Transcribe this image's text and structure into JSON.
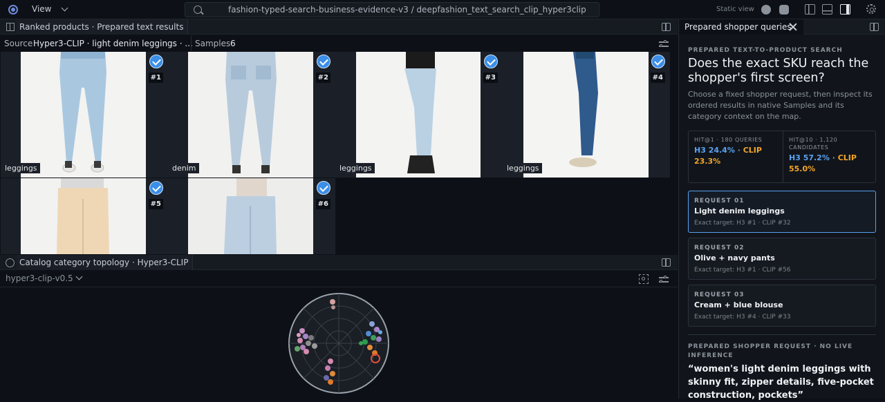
{
  "topbar": {
    "view_label": "View",
    "search_value": "fashion-typed-search-business-evidence-v3 / deepfashion_text_search_clip_hyper3clip",
    "static_label": "Static view"
  },
  "results_panel": {
    "title": "Ranked products · Prepared text results",
    "source_label": "Source",
    "source_value": "Hyper3-CLIP · light denim leggings · ...",
    "samples_label": "Samples",
    "samples_count": "6",
    "tiles": [
      {
        "tag": "leggings",
        "rank": "#1",
        "variant": "light-jeans-back"
      },
      {
        "tag": "denim",
        "rank": "#2",
        "variant": "light-jeans-back-2"
      },
      {
        "tag": "leggings",
        "rank": "#3",
        "variant": "side-boots"
      },
      {
        "tag": "leggings",
        "rank": "#4",
        "variant": "dark-side"
      },
      {
        "tag": "",
        "rank": "#5",
        "variant": "cream"
      },
      {
        "tag": "",
        "rank": "#6",
        "variant": "acid-front"
      }
    ]
  },
  "map_panel": {
    "title": "Catalog category topology · Hyper3-CLIP",
    "model_select": "hyper3-clip-v0.5"
  },
  "right_panel": {
    "tab_title": "Prepared shopper queries",
    "kicker": "PREPARED TEXT-TO-PRODUCT SEARCH",
    "heading": "Does the exact SKU reach the shopper's first screen?",
    "description": "Choose a fixed shopper request, then inspect its ordered results in native Samples and its category context on the map.",
    "metric1_label": "HIT@1 · 180 QUERIES",
    "metric1_h3": "H3 24.4%",
    "metric1_clip": "CLIP 23.3%",
    "metric2_label": "HIT@10 · 1,120 CANDIDATES",
    "metric2_h3": "H3 57.2%",
    "metric2_clip": "CLIP 55.0%",
    "requests": [
      {
        "num": "REQUEST 01",
        "title": "Light denim leggings",
        "sub": "Exact target: H3 #1 · CLIP #32"
      },
      {
        "num": "REQUEST 02",
        "title": "Olive + navy pants",
        "sub": "Exact target: H3 #1 · CLIP #56"
      },
      {
        "num": "REQUEST 03",
        "title": "Cream + blue blouse",
        "sub": "Exact target: H3 #4 · CLIP #33"
      }
    ],
    "prepared_kicker": "PREPARED SHOPPER REQUEST · NO LIVE INFERENCE",
    "quote": "“women's light denim leggings with skinny fit, zipper details, five-pocket construction, pockets”"
  },
  "colors": {
    "accent": "#3b8fe8",
    "orange": "#f1a52b",
    "background": "#0d1117"
  }
}
